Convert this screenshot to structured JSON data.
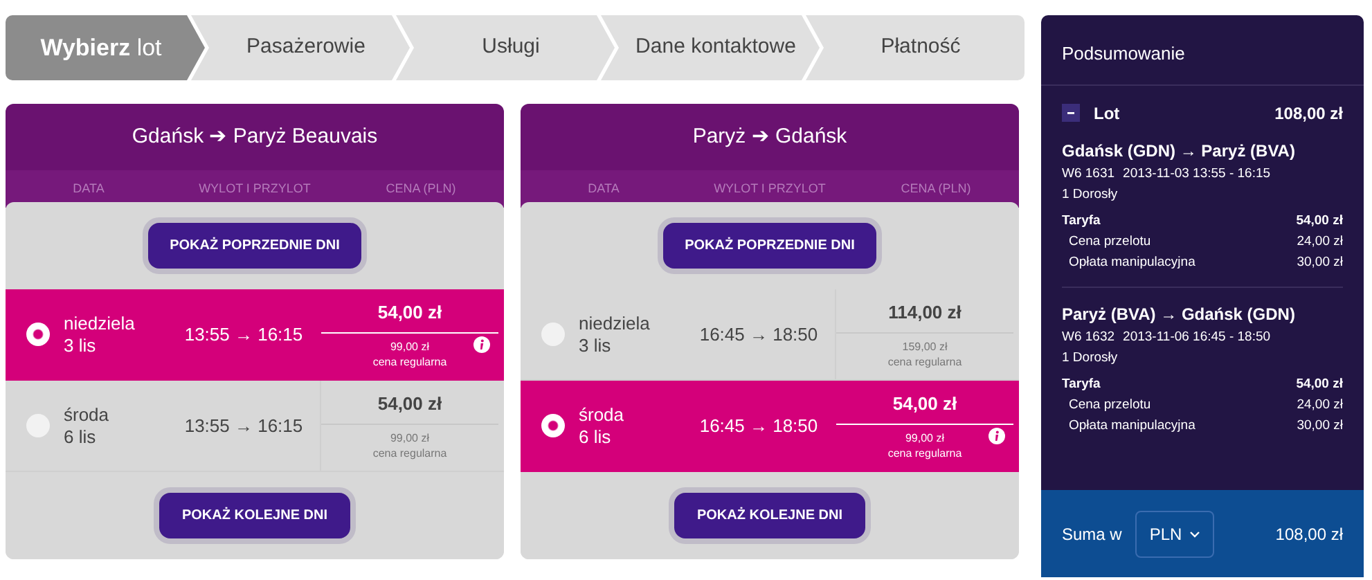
{
  "steps": [
    {
      "label": "**Wybierz** lot",
      "selected": true
    },
    {
      "label": "Pasażerowie",
      "selected": false
    },
    {
      "label": "Usługi",
      "selected": false
    },
    {
      "label": "Dane kontaktowe",
      "selected": false
    },
    {
      "label": "Płatność",
      "selected": false
    }
  ],
  "flights": [
    {
      "route": "Gdańsk ➔ Paryż Beauvais",
      "columns": [
        "DATA",
        "WYLOT I PRZYLOT",
        "CENA (PLN)"
      ],
      "prev_button": "POKAŻ POPRZEDNIE DNI",
      "next_button": "POKAŻ KOLEJNE DNI",
      "rows": [
        {
          "day": "niedziela",
          "date": "3 lis",
          "times": "13:55 → 16:15",
          "price": "54,00 zł",
          "old_price": "99,00 zł",
          "old_price_label": "cena regularna",
          "selected": true
        },
        {
          "day": "środa",
          "date": "6 lis",
          "times": "13:55 → 16:15",
          "price": "54,00 zł",
          "old_price": "99,00 zł",
          "old_price_label": "cena regularna",
          "selected": false
        }
      ]
    },
    {
      "route": "Paryż ➔ Gdańsk",
      "columns": [
        "DATA",
        "WYLOT I PRZYLOT",
        "CENA (PLN)"
      ],
      "prev_button": "POKAŻ POPRZEDNIE DNI",
      "next_button": "POKAŻ KOLEJNE DNI",
      "rows": [
        {
          "day": "niedziela",
          "date": "3 lis",
          "times": "16:45 → 18:50",
          "price": "114,00 zł",
          "old_price": "159,00 zł",
          "old_price_label": "cena regularna",
          "selected": false
        },
        {
          "day": "środa",
          "date": "6 lis",
          "times": "16:45 → 18:50",
          "price": "54,00 zł",
          "old_price": "99,00 zł",
          "old_price_label": "cena regularna",
          "selected": true
        }
      ]
    }
  ],
  "summary": {
    "title": "Podsumowanie",
    "section": {
      "label": "Lot",
      "total": "108,00 zł",
      "expanded": true
    },
    "legs": [
      {
        "route": "Gdańsk (GDN) → Paryż (BVA)",
        "flight_number": "W6 1631",
        "schedule": "2013-11-03 13:55 - 16:15",
        "passengers": "1 Dorosły",
        "fare_label": "Taryfa",
        "fare": "54,00 zł",
        "items": [
          {
            "label": "Cena przelotu",
            "amount": "24,00 zł"
          },
          {
            "label": "Opłata manipulacyjna",
            "amount": "30,00 zł"
          }
        ]
      },
      {
        "route": "Paryż (BVA) → Gdańsk (GDN)",
        "flight_number": "W6 1632",
        "schedule": "2013-11-06 16:45 - 18:50",
        "passengers": "1 Dorosły",
        "fare_label": "Taryfa",
        "fare": "54,00 zł",
        "items": [
          {
            "label": "Cena przelotu",
            "amount": "24,00 zł"
          },
          {
            "label": "Opłata manipulacyjna",
            "amount": "30,00 zł"
          }
        ]
      }
    ],
    "footer": {
      "label": "Suma w",
      "currency": "PLN",
      "total": "108,00 zł"
    }
  }
}
